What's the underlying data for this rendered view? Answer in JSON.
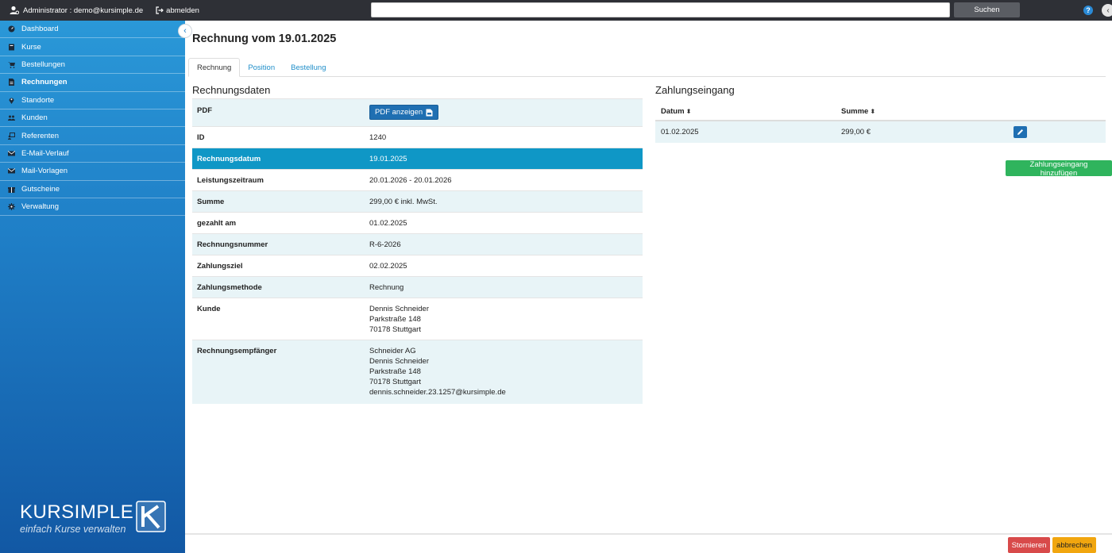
{
  "topbar": {
    "user_label": "Administrator : demo@kursimple.de",
    "logout_label": "abmelden",
    "search_value": "",
    "search_button": "Suchen",
    "help_label": "?"
  },
  "sidebar": {
    "items": [
      {
        "label": "Dashboard",
        "icon": "dashboard-icon"
      },
      {
        "label": "Kurse",
        "icon": "book-icon"
      },
      {
        "label": "Bestellungen",
        "icon": "cart-icon"
      },
      {
        "label": "Rechnungen",
        "icon": "invoice-icon",
        "active": true
      },
      {
        "label": "Standorte",
        "icon": "location-icon"
      },
      {
        "label": "Kunden",
        "icon": "users-icon"
      },
      {
        "label": "Referenten",
        "icon": "teacher-icon"
      },
      {
        "label": "E-Mail-Verlauf",
        "icon": "mail-icon"
      },
      {
        "label": "Mail-Vorlagen",
        "icon": "mail-template-icon"
      },
      {
        "label": "Gutscheine",
        "icon": "gift-icon"
      },
      {
        "label": "Verwaltung",
        "icon": "gear-icon"
      }
    ],
    "brand_name": "KURSIMPLE",
    "brand_tagline": "einfach Kurse verwalten"
  },
  "page": {
    "title": "Rechnung vom 19.01.2025",
    "tabs": [
      "Rechnung",
      "Position",
      "Bestellung"
    ]
  },
  "invoice": {
    "section_title": "Rechnungsdaten",
    "pdf_label": "PDF",
    "pdf_button": "PDF anzeigen",
    "rows": [
      {
        "key": "ID",
        "value": "1240"
      },
      {
        "key": "Rechnungsdatum",
        "value": "19.01.2025"
      },
      {
        "key": "Leistungszeitraum",
        "value": "20.01.2026 - 20.01.2026"
      },
      {
        "key": "Summe",
        "value": "299,00 € inkl. MwSt."
      },
      {
        "key": "gezahlt am",
        "value": "01.02.2025"
      },
      {
        "key": "Rechnungsnummer",
        "value": "R-6-2026"
      },
      {
        "key": "Zahlungsziel",
        "value": "02.02.2025"
      },
      {
        "key": "Zahlungsmethode",
        "value": "Rechnung"
      }
    ],
    "kunde": {
      "key": "Kunde",
      "lines": [
        "Dennis Schneider",
        "Parkstraße 148",
        "70178 Stuttgart"
      ]
    },
    "empfaenger": {
      "key": "Rechnungsempfänger",
      "lines": [
        "Schneider AG",
        "Dennis Schneider",
        "Parkstraße 148",
        "70178 Stuttgart",
        "dennis.schneider.23.1257@kursimple.de"
      ]
    }
  },
  "payments": {
    "section_title": "Zahlungseingang",
    "col_datum": "Datum",
    "col_summe": "Summe",
    "rows": [
      {
        "datum": "01.02.2025",
        "summe": "299,00 €"
      }
    ],
    "add_button": "Zahlungseingang hinzufügen"
  },
  "footer": {
    "storno_button": "Stornieren",
    "cancel_button": "abbrechen"
  },
  "colors": {
    "highlight_row": "#0f97c6",
    "storno": "#d84a4a",
    "cancel": "#f1a60f",
    "add": "#2fb45d"
  }
}
